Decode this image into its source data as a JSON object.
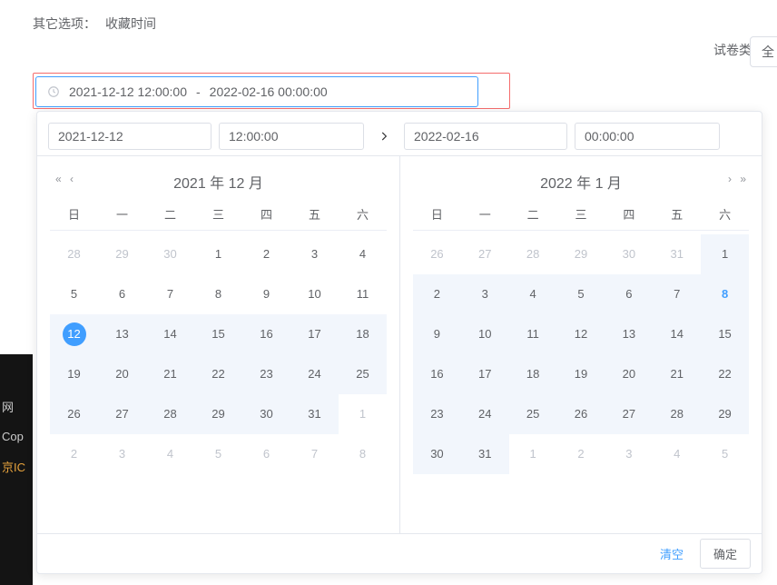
{
  "labels": {
    "other_options": "其它选项：",
    "collect_time": "收藏时间",
    "paper_type": "试卷类型：",
    "paper_type_value": "全"
  },
  "range": {
    "start": "2021-12-12 12:00:00",
    "sep": "-",
    "end": "2022-02-16 00:00:00"
  },
  "picker": {
    "start_date": "2021-12-12",
    "start_time": "12:00:00",
    "end_date": "2022-02-16",
    "end_time": "00:00:00",
    "left_title": "2021 年 12 月",
    "right_title": "2022 年 1 月",
    "dow": [
      "日",
      "一",
      "二",
      "三",
      "四",
      "五",
      "六"
    ],
    "left_cells": [
      {
        "n": 28,
        "other": true
      },
      {
        "n": 29,
        "other": true
      },
      {
        "n": 30,
        "other": true
      },
      {
        "n": 1
      },
      {
        "n": 2
      },
      {
        "n": 3
      },
      {
        "n": 4
      },
      {
        "n": 5
      },
      {
        "n": 6
      },
      {
        "n": 7
      },
      {
        "n": 8
      },
      {
        "n": 9
      },
      {
        "n": 10
      },
      {
        "n": 11
      },
      {
        "n": 12,
        "sel": true,
        "in": true
      },
      {
        "n": 13,
        "in": true
      },
      {
        "n": 14,
        "in": true
      },
      {
        "n": 15,
        "in": true
      },
      {
        "n": 16,
        "in": true
      },
      {
        "n": 17,
        "in": true
      },
      {
        "n": 18,
        "in": true
      },
      {
        "n": 19,
        "in": true
      },
      {
        "n": 20,
        "in": true
      },
      {
        "n": 21,
        "in": true
      },
      {
        "n": 22,
        "in": true
      },
      {
        "n": 23,
        "in": true
      },
      {
        "n": 24,
        "in": true
      },
      {
        "n": 25,
        "in": true
      },
      {
        "n": 26,
        "in": true
      },
      {
        "n": 27,
        "in": true
      },
      {
        "n": 28,
        "in": true
      },
      {
        "n": 29,
        "in": true
      },
      {
        "n": 30,
        "in": true
      },
      {
        "n": 31,
        "in": true
      },
      {
        "n": 1,
        "other": true
      },
      {
        "n": 2,
        "other": true
      },
      {
        "n": 3,
        "other": true
      },
      {
        "n": 4,
        "other": true
      },
      {
        "n": 5,
        "other": true
      },
      {
        "n": 6,
        "other": true
      },
      {
        "n": 7,
        "other": true
      },
      {
        "n": 8,
        "other": true
      }
    ],
    "right_cells": [
      {
        "n": 26,
        "other": true
      },
      {
        "n": 27,
        "other": true
      },
      {
        "n": 28,
        "other": true
      },
      {
        "n": 29,
        "other": true
      },
      {
        "n": 30,
        "other": true
      },
      {
        "n": 31,
        "other": true
      },
      {
        "n": 1,
        "in": true
      },
      {
        "n": 2,
        "in": true
      },
      {
        "n": 3,
        "in": true
      },
      {
        "n": 4,
        "in": true
      },
      {
        "n": 5,
        "in": true
      },
      {
        "n": 6,
        "in": true
      },
      {
        "n": 7,
        "in": true
      },
      {
        "n": 8,
        "in": true,
        "end": true
      },
      {
        "n": 9,
        "in": true
      },
      {
        "n": 10,
        "in": true
      },
      {
        "n": 11,
        "in": true
      },
      {
        "n": 12,
        "in": true
      },
      {
        "n": 13,
        "in": true
      },
      {
        "n": 14,
        "in": true
      },
      {
        "n": 15,
        "in": true
      },
      {
        "n": 16,
        "in": true
      },
      {
        "n": 17,
        "in": true
      },
      {
        "n": 18,
        "in": true
      },
      {
        "n": 19,
        "in": true
      },
      {
        "n": 20,
        "in": true
      },
      {
        "n": 21,
        "in": true
      },
      {
        "n": 22,
        "in": true
      },
      {
        "n": 23,
        "in": true
      },
      {
        "n": 24,
        "in": true
      },
      {
        "n": 25,
        "in": true
      },
      {
        "n": 26,
        "in": true
      },
      {
        "n": 27,
        "in": true
      },
      {
        "n": 28,
        "in": true
      },
      {
        "n": 29,
        "in": true
      },
      {
        "n": 30,
        "in": true
      },
      {
        "n": 31,
        "in": true
      },
      {
        "n": 1,
        "other": true
      },
      {
        "n": 2,
        "other": true
      },
      {
        "n": 3,
        "other": true
      },
      {
        "n": 4,
        "other": true
      },
      {
        "n": 5,
        "other": true
      }
    ],
    "clear": "清空",
    "confirm": "确定"
  },
  "footer_text": {
    "a": "网",
    "b": "Cop",
    "c": "京IC"
  }
}
